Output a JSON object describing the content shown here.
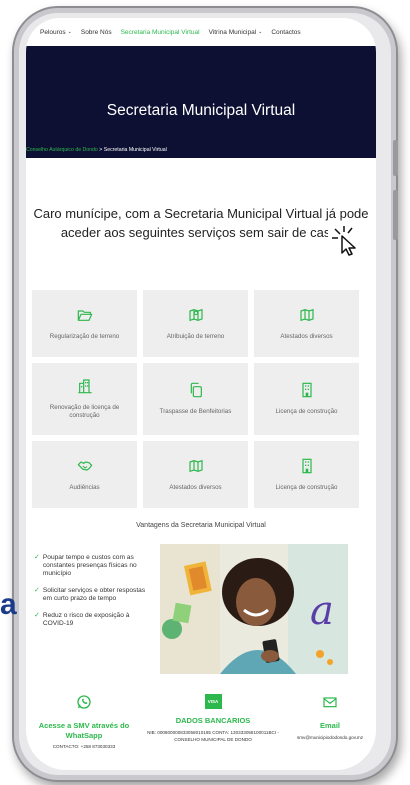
{
  "nav": {
    "items": [
      "Pelouros",
      "Sobre Nós",
      "Secretaria Municipal Virtual",
      "Vitrina Municipal",
      "Contactos"
    ],
    "active_index": 2
  },
  "hero": {
    "title": "Secretaria Municipal Virtual",
    "breadcrumb_link": "Conselho Autárquico de Dondo",
    "breadcrumb_sep": " > ",
    "breadcrumb_current": "Secretaria Municipal Virtual"
  },
  "intro": {
    "line1": "Caro munícipe, com a Secretaria Municipal Virtual já pode",
    "line2": "aceder aos seguintes serviços sem sair de casa:"
  },
  "services": [
    {
      "label": "Regularização de terreno",
      "icon": "folder-open-icon"
    },
    {
      "label": "Atribuição de terreno",
      "icon": "map-pin-icon"
    },
    {
      "label": "Atestados diversos",
      "icon": "map-icon"
    },
    {
      "label": "Renovação de licença de construção",
      "icon": "city-icon"
    },
    {
      "label": "Traspasse de Benfeitorias",
      "icon": "copy-icon"
    },
    {
      "label": "Licença de construção",
      "icon": "building-icon"
    },
    {
      "label": "Audiências",
      "icon": "handshake-icon"
    },
    {
      "label": "Atestados diversos",
      "icon": "map-icon"
    },
    {
      "label": "Licença de construção",
      "icon": "building-icon"
    }
  ],
  "advantages": {
    "title": "Vantagens da Secretaria Municipal Virtual",
    "items": [
      "Poupar tempo e custos com as constantes presenças físicas no município",
      "Solicitar serviços e obter respostas em curto prazo de tempo",
      "Reduz o risco de exposição à COVID-19"
    ]
  },
  "footer": {
    "whatsapp_title": "Acesse a SMV através do WhatSapp",
    "whatsapp_contact": "CONTACTO: +258 873030333",
    "bank_title": "DADOS BANCARIOS",
    "bank_visa": "VISA",
    "bank_line1": "NIB: 000800000833058010185 CONTA: 130333058100011BCI -",
    "bank_line2": "CONSELHO MUNICIPAL DE DONDO",
    "email_title": "Email",
    "email_value": "smv@municipiododondo.gov.mz"
  },
  "stray_letter": "a",
  "colors": {
    "accent": "#2db84d",
    "hero_bg": "#0d1033",
    "tile_bg": "#eeeeee"
  }
}
